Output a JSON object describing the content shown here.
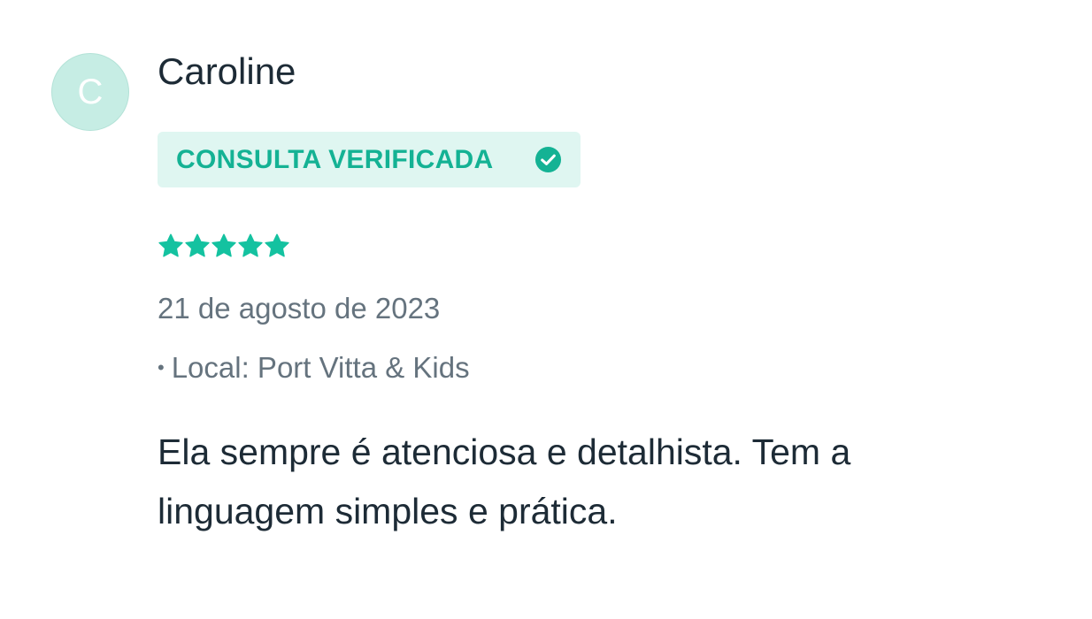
{
  "review": {
    "avatar_initial": "C",
    "author_name": "Caroline",
    "badge_label": "CONSULTA VERIFICADA",
    "rating": 5,
    "rating_max": 5,
    "date": "21 de agosto de 2023",
    "location_bullet": "•",
    "location": "Local: Port Vitta & Kids",
    "comment": "Ela sempre é atenciosa e detalhista. Tem a linguagem simples e prática."
  },
  "colors": {
    "accent": "#14b294",
    "star": "#14c2a0",
    "badge_bg": "#dff6f1",
    "avatar_bg": "#c6ede4",
    "text_primary": "#1d2b36",
    "text_secondary": "#65737e"
  },
  "icons": {
    "badge": "check-circle-icon",
    "rating": "star-icon"
  }
}
